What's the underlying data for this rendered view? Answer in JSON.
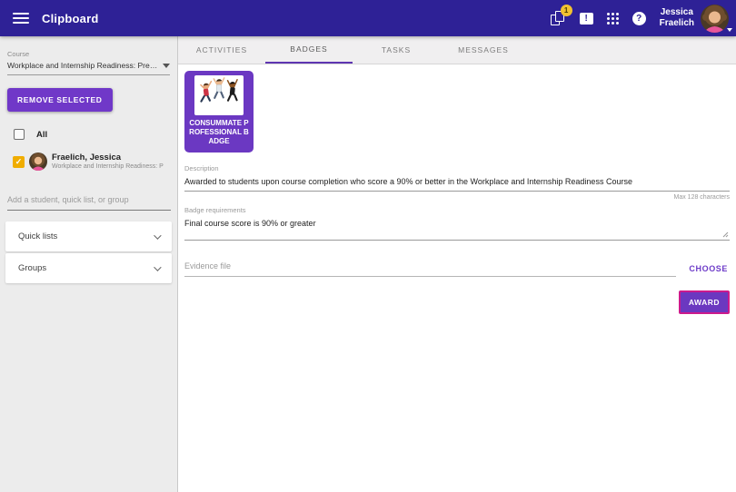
{
  "header": {
    "title": "Clipboard",
    "notification_count": "1",
    "user": {
      "name_line1": "Jessica",
      "name_line2": "Fraelich"
    }
  },
  "icons": {
    "help_glyph": "?",
    "alert_glyph": "!",
    "check_glyph": "✓"
  },
  "tabs": [
    {
      "label": "ACTIVITIES",
      "active": false
    },
    {
      "label": "BADGES",
      "active": true
    },
    {
      "label": "TASKS",
      "active": false
    },
    {
      "label": "MESSAGES",
      "active": false
    }
  ],
  "sidebar": {
    "course_label": "Course",
    "course_value": "Workplace and Internship Readiness: Prepar...",
    "remove_selected_label": "REMOVE SELECTED",
    "select_all_label": "All",
    "student": {
      "name": "Fraelich, Jessica",
      "course": "Workplace and Internship Readiness: P",
      "checked": true
    },
    "add_placeholder": "Add a student, quick list, or group",
    "quick_lists_label": "Quick lists",
    "groups_label": "Groups"
  },
  "badge_panel": {
    "badge_name": "CONSUMMATE PROFESSIONAL BADGE",
    "description_label": "Description",
    "description_value": "Awarded to students upon course completion who score a 90% or better in the Workplace and Internship Readiness Course",
    "max_chars_note": "Max 128 characters",
    "requirements_label": "Badge requirements",
    "requirements_value": "Final course score is 90% or greater",
    "evidence_placeholder": "Evidence file",
    "choose_label": "CHOOSE",
    "award_label": "AWARD"
  },
  "colors": {
    "header_bg": "#2e2196",
    "accent_purple": "#7038c8",
    "badge_card_purple": "#6b38c2",
    "tab_underline": "#5e35b1",
    "award_border": "#cc1a8c",
    "checkbox_checked_yellow": "#f0ad00",
    "notification_badge_yellow": "#f2c230",
    "sidebar_bg": "#ececec"
  }
}
